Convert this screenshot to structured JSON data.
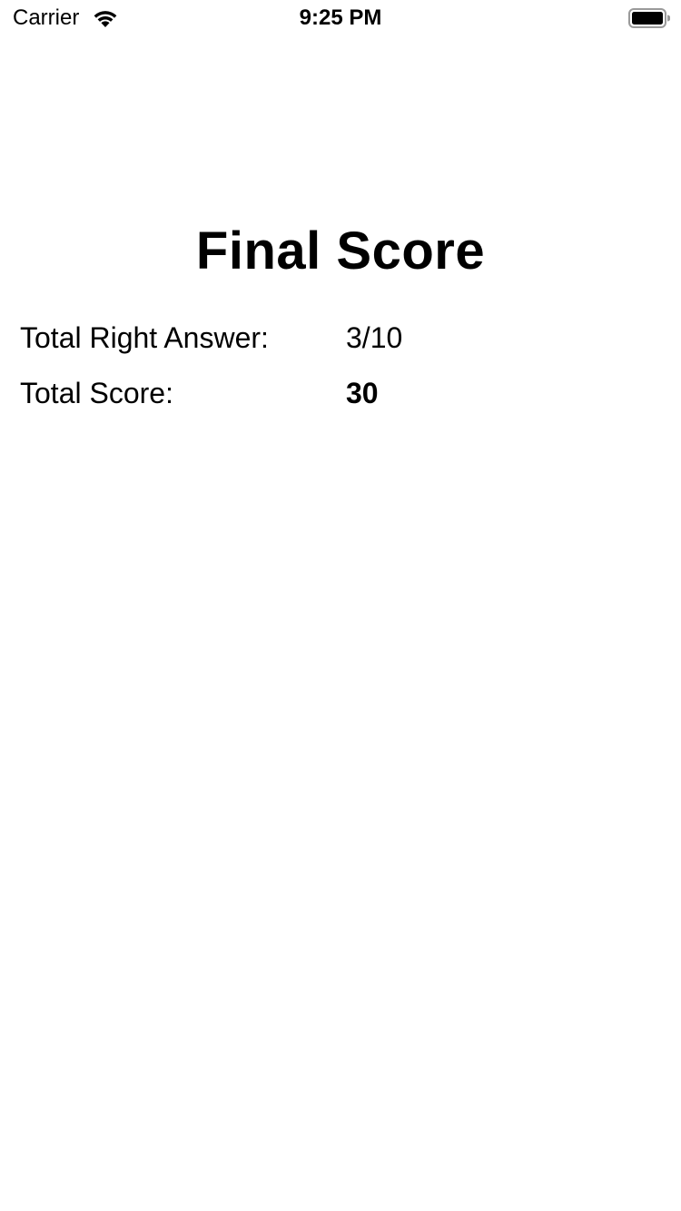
{
  "status_bar": {
    "carrier": "Carrier",
    "time": "9:25 PM",
    "wifi_icon": "wifi-icon",
    "battery_icon": "battery-icon"
  },
  "screen": {
    "title": "Final Score",
    "right_answers_label": "Total Right Answer:",
    "right_answers_value": "3/10",
    "total_score_label": "Total Score:",
    "total_score_value": "30"
  },
  "colors": {
    "background": "#ffffff",
    "text": "#000000"
  }
}
